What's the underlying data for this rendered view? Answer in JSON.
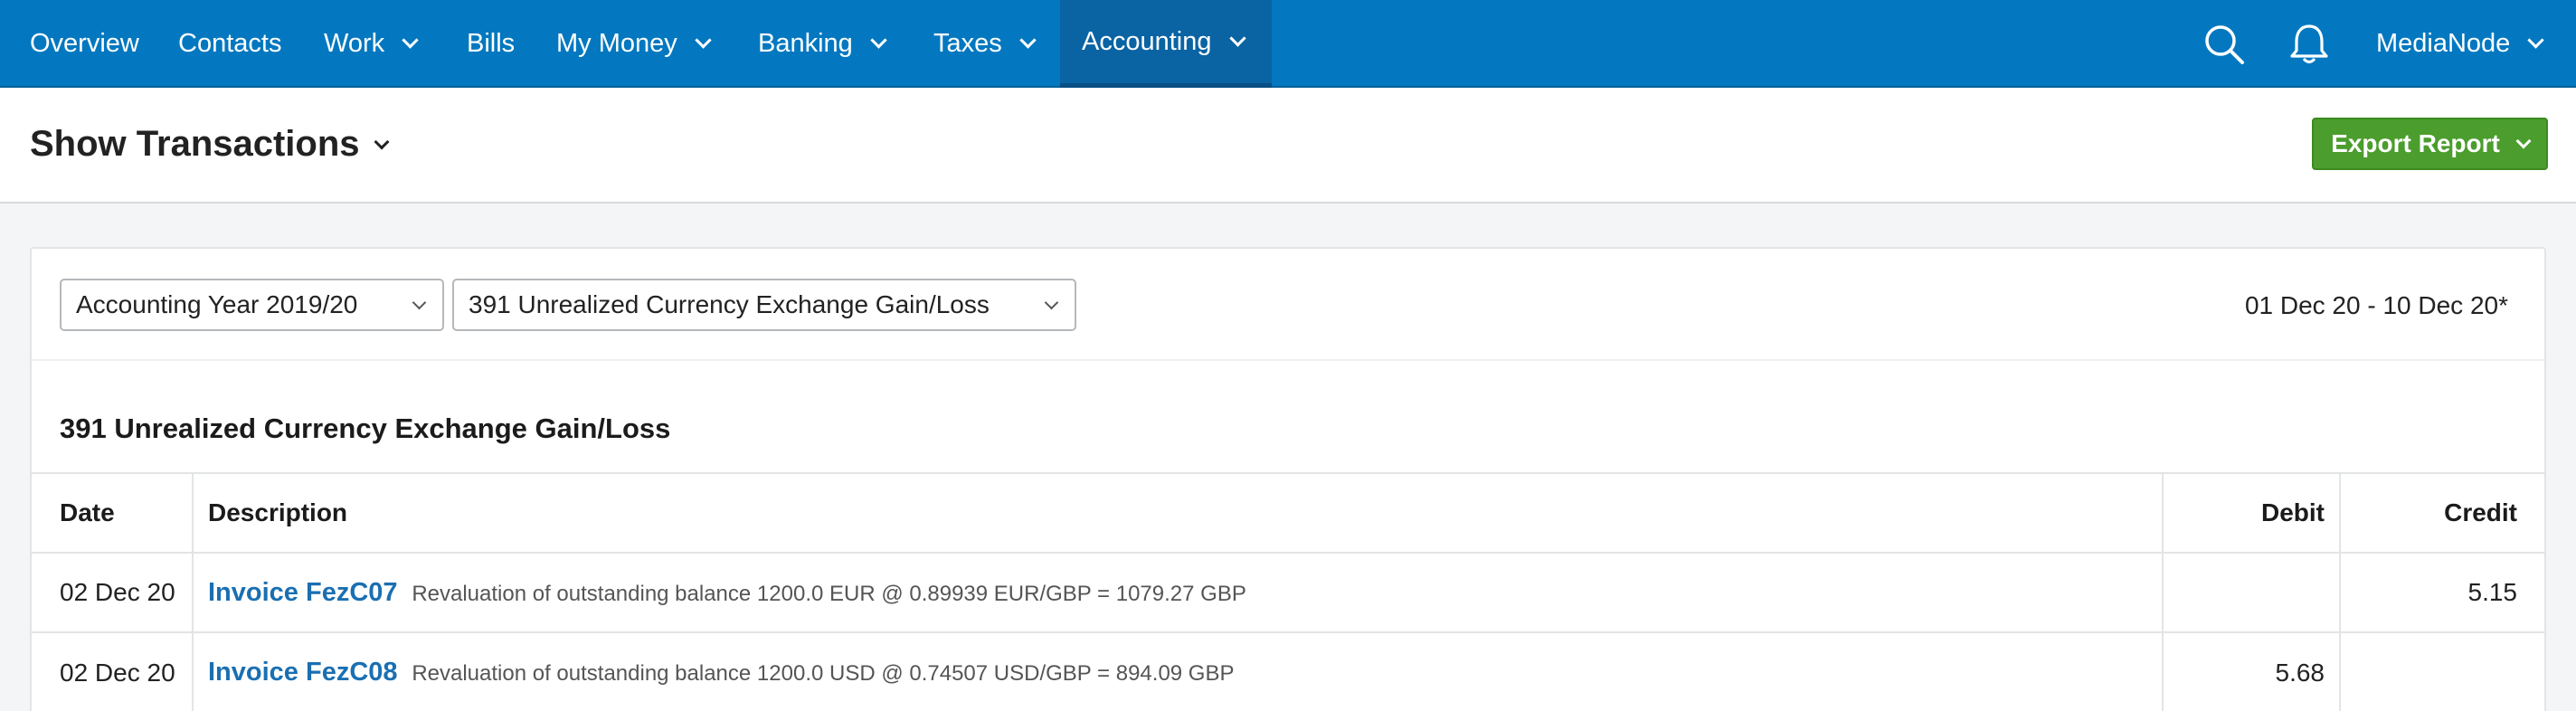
{
  "nav": {
    "items": [
      {
        "label": "Overview",
        "has_dropdown": false
      },
      {
        "label": "Contacts",
        "has_dropdown": false
      },
      {
        "label": "Work",
        "has_dropdown": true
      },
      {
        "label": "Bills",
        "has_dropdown": false
      },
      {
        "label": "My Money",
        "has_dropdown": true
      },
      {
        "label": "Banking",
        "has_dropdown": true
      },
      {
        "label": "Taxes",
        "has_dropdown": true
      },
      {
        "label": "Accounting",
        "has_dropdown": true,
        "active": true
      }
    ],
    "icons": [
      "search-icon",
      "bell-icon"
    ],
    "account_label": "MediaNode",
    "colors": {
      "bar": "#0378c0",
      "active": "#0a63a3"
    }
  },
  "header": {
    "title": "Show Transactions",
    "export_label": "Export Report",
    "export_color": "#4b9d2d"
  },
  "filters": {
    "year_select": "Accounting Year 2019/20",
    "account_select": "391 Unrealized Currency Exchange Gain/Loss",
    "date_range": "01 Dec 20 - 10 Dec 20*"
  },
  "account": {
    "title": "391 Unrealized Currency Exchange Gain/Loss"
  },
  "table": {
    "headers": {
      "date": "Date",
      "description": "Description",
      "debit": "Debit",
      "credit": "Credit"
    },
    "rows": [
      {
        "date": "02 Dec 20",
        "link": "Invoice FezC07",
        "detail": "Revaluation of outstanding balance 1200.0 EUR @ 0.89939 EUR/GBP = 1079.27 GBP",
        "debit": "",
        "credit": "5.15"
      },
      {
        "date": "02 Dec 20",
        "link": "Invoice FezC08",
        "detail": "Revaluation of outstanding balance 1200.0 USD @ 0.74507 USD/GBP = 894.09 GBP",
        "debit": "5.68",
        "credit": ""
      }
    ]
  }
}
